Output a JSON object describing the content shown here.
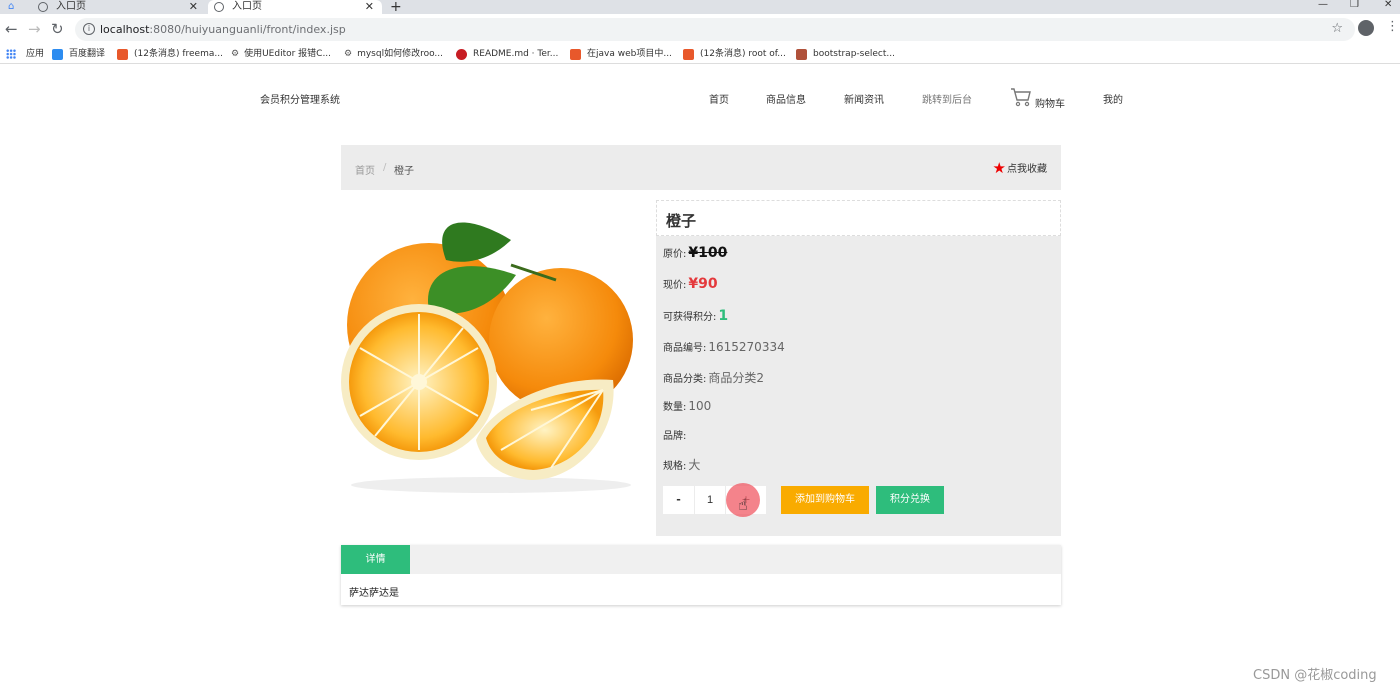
{
  "browser": {
    "tabs": [
      {
        "title": "入口页"
      },
      {
        "title": "入口页"
      }
    ],
    "new_tab_label": "+",
    "url_host": "localhost",
    "url_rest": ":8080/huiyuanguanli/front/index.jsp",
    "bookmarks": [
      {
        "label": "应用",
        "icon": "apps-grid-icon"
      },
      {
        "label": "百度翻译",
        "icon": "baidu-translate-icon",
        "color": "#2d8cf0"
      },
      {
        "label": "(12条消息) freema...",
        "icon": "csdn-icon",
        "color": "#e8582b"
      },
      {
        "label": "使用UEditor 报错C...",
        "icon": "gear-bookmark-icon",
        "color": "#555555"
      },
      {
        "label": "mysql如何修改roo...",
        "icon": "gear-bookmark-icon",
        "color": "#555555"
      },
      {
        "label": "README.md · Ter...",
        "icon": "gitee-icon",
        "color": "#c71d23"
      },
      {
        "label": "在java web项目中...",
        "icon": "csdn-icon",
        "color": "#e8582b"
      },
      {
        "label": "(12条消息) root of...",
        "icon": "csdn-icon",
        "color": "#e8582b"
      },
      {
        "label": "bootstrap-select...",
        "icon": "bookmark-page-icon",
        "color": "#b0513a"
      }
    ]
  },
  "header": {
    "site_name": "会员积分管理系统",
    "nav": [
      {
        "label": "首页"
      },
      {
        "label": "商品信息"
      },
      {
        "label": "新闻资讯"
      },
      {
        "label": "跳转到后台"
      },
      {
        "label": "购物车"
      },
      {
        "label": "我的"
      }
    ]
  },
  "breadcrumb": {
    "home": "首页",
    "separator": "/",
    "current": "橙子",
    "favorite": "点我收藏"
  },
  "product": {
    "name": "橙子",
    "original_price_label": "原价:",
    "original_price": "¥100",
    "current_price_label": "现价:",
    "current_price": "¥90",
    "points_label": "可获得积分:",
    "points": "1",
    "code_label": "商品编号:",
    "code": "1615270334",
    "category_label": "商品分类:",
    "category": "商品分类2",
    "quantity_label": "数量:",
    "quantity": "100",
    "brand_label": "品牌:",
    "brand": "",
    "spec_label": "规格:",
    "spec": "大",
    "qty_minus": "-",
    "qty_value": "1",
    "qty_plus": "+",
    "add_to_cart": "添加到购物车",
    "redeem_points": "积分兑换"
  },
  "details": {
    "tab_label": "详情",
    "content": "萨达萨达是"
  },
  "watermark": "CSDN @花椒coding",
  "colors": {
    "accent_green": "#2ebd7c",
    "accent_orange": "#f9ab00",
    "price_red": "#e4393c",
    "panel_gray": "#ececec"
  }
}
